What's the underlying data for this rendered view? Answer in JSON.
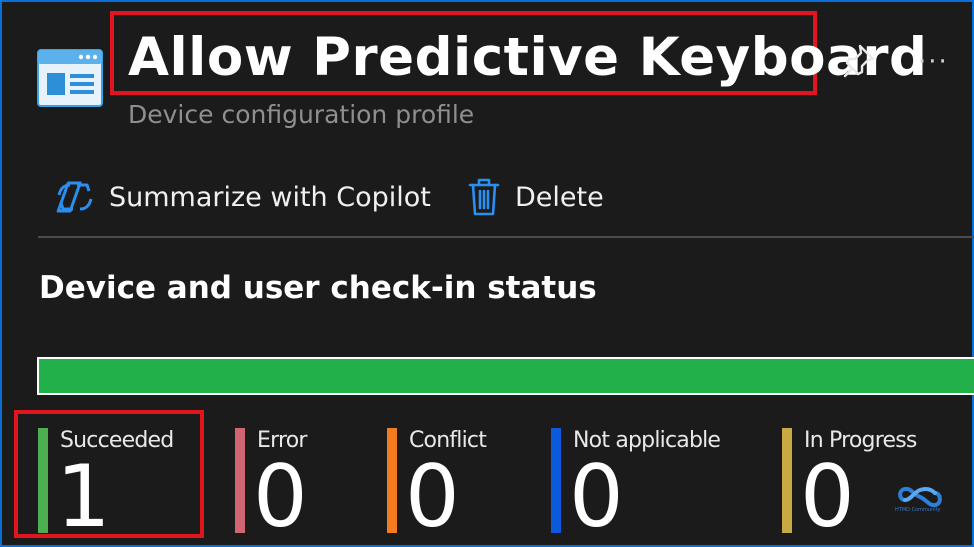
{
  "header": {
    "title": "Allow Predictive Keyboard",
    "subtitle": "Device configuration profile",
    "icon": "configuration-profile-icon",
    "more_label": "···"
  },
  "toolbar": {
    "copilot_label": "Summarize with Copilot",
    "delete_label": "Delete"
  },
  "status": {
    "title": "Device and user check-in status",
    "succeeded_fraction": 1.0,
    "items": [
      {
        "label": "Succeeded",
        "value": "1",
        "color": "#4caf50"
      },
      {
        "label": "Error",
        "value": "0",
        "color": "#d06672"
      },
      {
        "label": "Conflict",
        "value": "0",
        "color": "#f47c20"
      },
      {
        "label": "Not applicable",
        "value": "0",
        "color": "#0c5adb"
      },
      {
        "label": "In Progress",
        "value": "0",
        "color": "#c9a944"
      }
    ]
  },
  "colors": {
    "background": "#1b1b1b",
    "accent": "#0a6fd6",
    "highlight": "#e0151d",
    "progress": "#22b04b"
  },
  "watermark": {
    "text": "HTMD Community"
  }
}
